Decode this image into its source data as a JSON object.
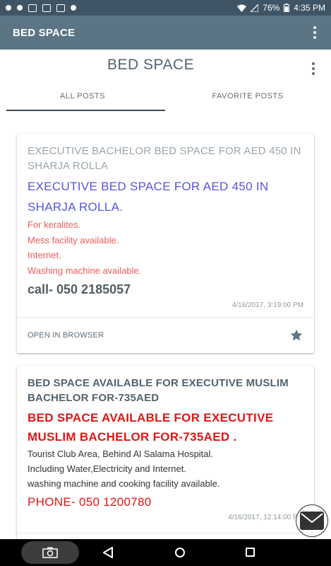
{
  "status_bar": {
    "battery": "76%",
    "time": "4:35 PM"
  },
  "app_bar": {
    "title": "BED SPACE",
    "menu_icon": "more-vert-icon"
  },
  "page_header": {
    "title": "BED SPACE",
    "menu_icon": "more-vert-icon"
  },
  "tabs": [
    {
      "label": "ALL POSTS",
      "active": true
    },
    {
      "label": "FAVORITE POSTS",
      "active": false
    }
  ],
  "posts": [
    {
      "title": "EXECUTIVE BACHELOR BED SPACE FOR AED 450 IN SHARJA ROLLA",
      "headline": "EXECUTIVE BED SPACE FOR AED 450 IN SHARJA ROLLA.",
      "lines": [
        "For keralites.",
        "Mess facility available.",
        "Internet.",
        "Washing machine available."
      ],
      "contact": "call- 050 2185057",
      "timestamp": "4/16/2017, 3:19:00 PM",
      "action_label": "OPEN IN BROWSER",
      "favorite_icon": "star-icon"
    },
    {
      "title": "BED SPACE AVAILABLE FOR EXECUTIVE MUSLIM BACHELOR FOR-735AED",
      "headline": "BED SPACE AVAILABLE FOR EXECUTIVE MUSLIM BACHELOR FOR-735AED .",
      "lines": [
        "Tourist Club Area, Behind Al Salama Hospital.",
        "Including Water,Electricity and Internet.",
        "washing machine and cooking facility available."
      ],
      "contact": "PHONE- 050 1200780",
      "timestamp": "4/16/2017, 12:14:00 PM"
    }
  ],
  "fab": {
    "icon": "mail-icon"
  },
  "colors": {
    "status_bar": "#3f5566",
    "app_bar": "#5c7585",
    "blue_headline": "#5555dd",
    "red_headline": "#e01515",
    "pink_text": "#ef5b5b"
  }
}
